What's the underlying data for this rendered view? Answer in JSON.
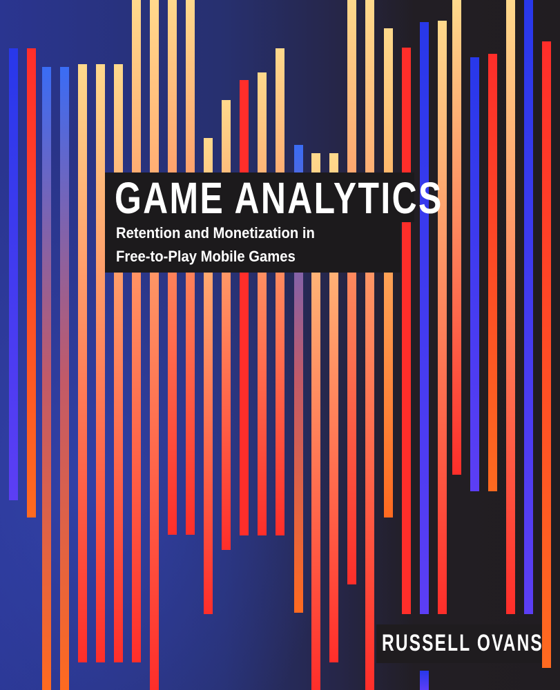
{
  "cover": {
    "title": "GAME ANALYTICS",
    "subtitle_line1": "Retention and Monetization in",
    "subtitle_line2": "Free-to-Play Mobile Games",
    "author": "RUSSELL OVANS"
  },
  "colors": {
    "peach": "#ffd98c",
    "red": "#ff2e2a",
    "orange": "#ff6a20",
    "blue": "#2838ea",
    "light_blue": "#3a6cf5",
    "violet": "#5c3ef5",
    "dusty_rose": "#c25a68",
    "text_box": "#1c1a1c",
    "text": "#ffffff"
  }
}
